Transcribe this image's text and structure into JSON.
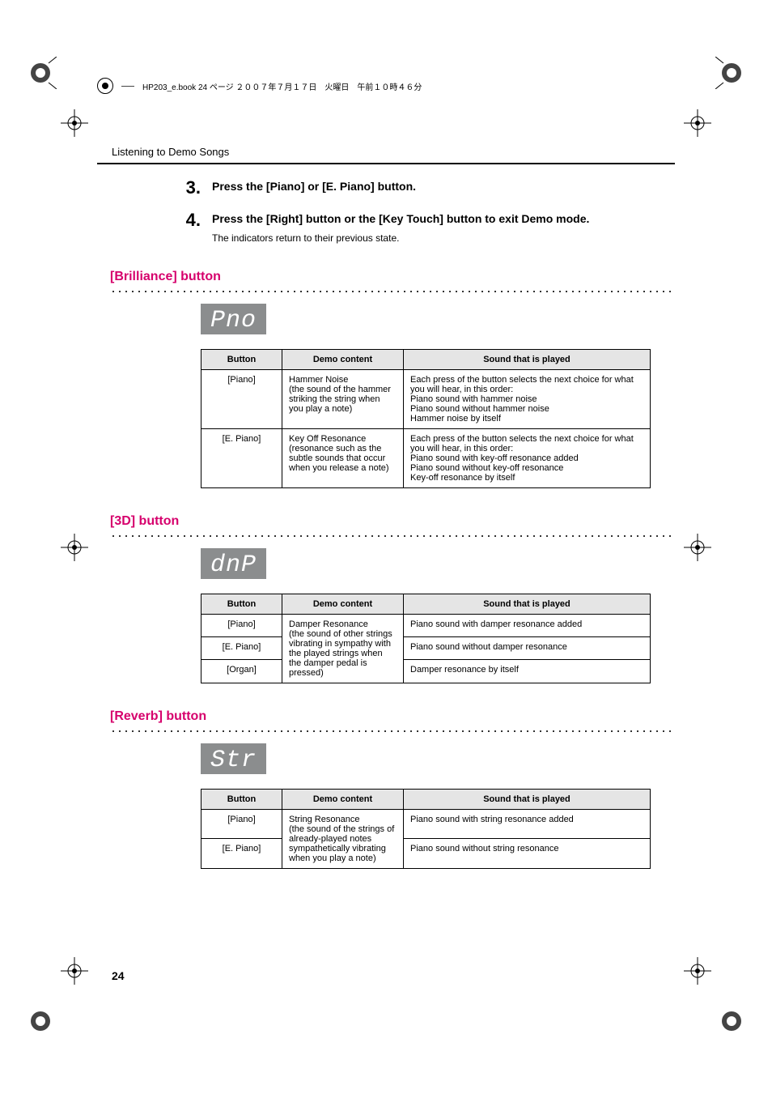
{
  "book_header": "HP203_e.book 24 ページ ２００７年７月１７日　火曜日　午前１０時４６分",
  "running_head": "Listening to Demo Songs",
  "page_number": "24",
  "steps": [
    {
      "num": "3.",
      "heading": "Press the [Piano] or [E. Piano] button.",
      "desc": ""
    },
    {
      "num": "4.",
      "heading": "Press the [Right] button or the [Key Touch] button to exit Demo mode.",
      "desc": "The indicators return to their previous state."
    }
  ],
  "sections": [
    {
      "title": "[Brilliance] button",
      "lcd": "Pno",
      "headers": [
        "Button",
        "Demo content",
        "Sound that is played"
      ],
      "rows": [
        {
          "button": "[Piano]",
          "demo": "Hammer Noise\n(the sound of the hammer striking the string when you play a note)",
          "sound": "Each press of the button selects the next choice for what you will hear, in this order:\nPiano sound with hammer noise\nPiano sound without hammer noise\nHammer noise by itself"
        },
        {
          "button": "[E. Piano]",
          "demo": "Key Off Resonance\n(resonance such as the subtle sounds that occur when you release a note)",
          "sound": "Each press of the button selects the next choice for what you will hear, in this order:\nPiano sound with key-off resonance added\nPiano sound without key-off resonance\nKey-off resonance by itself"
        }
      ]
    },
    {
      "title": "[3D] button",
      "lcd": "dnP",
      "headers": [
        "Button",
        "Demo content",
        "Sound that is played"
      ],
      "demo_shared": "Damper Resonance\n(the sound of other strings vibrating in sympathy with the played strings when the damper pedal is pressed)",
      "rows": [
        {
          "button": "[Piano]",
          "sound": "Piano sound with damper resonance added"
        },
        {
          "button": "[E. Piano]",
          "sound": "Piano sound without damper resonance"
        },
        {
          "button": "[Organ]",
          "sound": "Damper resonance by itself"
        }
      ]
    },
    {
      "title": "[Reverb] button",
      "lcd": "Str",
      "headers": [
        "Button",
        "Demo content",
        "Sound that is played"
      ],
      "demo_shared": "String Resonance\n(the sound of the strings of already-played notes sympathetically vibrating when you play a note)",
      "rows": [
        {
          "button": "[Piano]",
          "sound": "Piano sound with string resonance added"
        },
        {
          "button": "[E. Piano]",
          "sound": "Piano sound without string resonance"
        }
      ]
    }
  ]
}
